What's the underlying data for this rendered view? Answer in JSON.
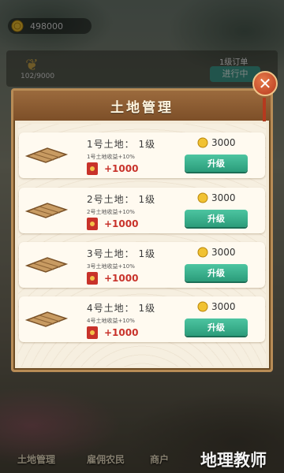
{
  "hud": {
    "coins": "498000",
    "order_progress": "102/9000",
    "order_title": "1级订单",
    "order_status": "进行中"
  },
  "modal": {
    "title": "土地管理",
    "plots": [
      {
        "name": "1号土地：  1级",
        "bonus": "1号土地收益+10%",
        "reward": "+1000",
        "cost": "3000",
        "button": "升级"
      },
      {
        "name": "2号土地：  1级",
        "bonus": "2号土地收益+10%",
        "reward": "+1000",
        "cost": "3000",
        "button": "升级"
      },
      {
        "name": "3号土地：  1级",
        "bonus": "3号土地收益+10%",
        "reward": "+1000",
        "cost": "3000",
        "button": "升级"
      },
      {
        "name": "4号土地：  1级",
        "bonus": "4号土地收益+10%",
        "reward": "+1000",
        "cost": "3000",
        "button": "升级"
      }
    ],
    "close_symbol": "✕"
  },
  "bottom": {
    "tab1": "土地管理",
    "tab2": "雇佣农民",
    "tab3": "商户"
  },
  "watermark": "地理教师"
}
